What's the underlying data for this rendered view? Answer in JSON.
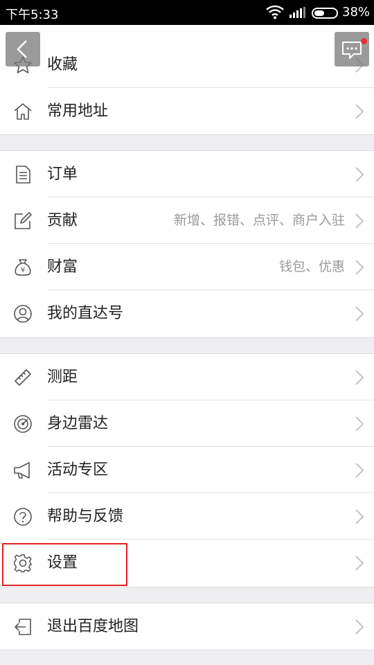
{
  "status_bar": {
    "time": "下午5:33",
    "battery_percent": "38%"
  },
  "top_buttons": {
    "back_icon": "chevron-left-icon",
    "message_icon": "message-icon",
    "accent": "#e8302f"
  },
  "sections": [
    {
      "items": [
        {
          "label": "收藏",
          "sub": "",
          "icon": "star-icon"
        },
        {
          "label": "常用地址",
          "sub": "",
          "icon": "home-icon"
        }
      ]
    },
    {
      "items": [
        {
          "label": "订单",
          "sub": "",
          "icon": "document-icon"
        },
        {
          "label": "贡献",
          "sub": "新增、报错、点评、商户入驻",
          "icon": "edit-icon"
        },
        {
          "label": "财富",
          "sub": "钱包、优惠",
          "icon": "money-bag-icon"
        },
        {
          "label": "我的直达号",
          "sub": "",
          "icon": "profile-circle-icon"
        }
      ]
    },
    {
      "items": [
        {
          "label": "测距",
          "sub": "",
          "icon": "ruler-icon"
        },
        {
          "label": "身边雷达",
          "sub": "",
          "icon": "radar-icon"
        },
        {
          "label": "活动专区",
          "sub": "",
          "icon": "megaphone-icon"
        },
        {
          "label": "帮助与反馈",
          "sub": "",
          "icon": "help-icon"
        },
        {
          "label": "设置",
          "sub": "",
          "icon": "gear-icon"
        }
      ]
    },
    {
      "items": [
        {
          "label": "退出百度地图",
          "sub": "",
          "icon": "exit-icon"
        }
      ]
    }
  ]
}
